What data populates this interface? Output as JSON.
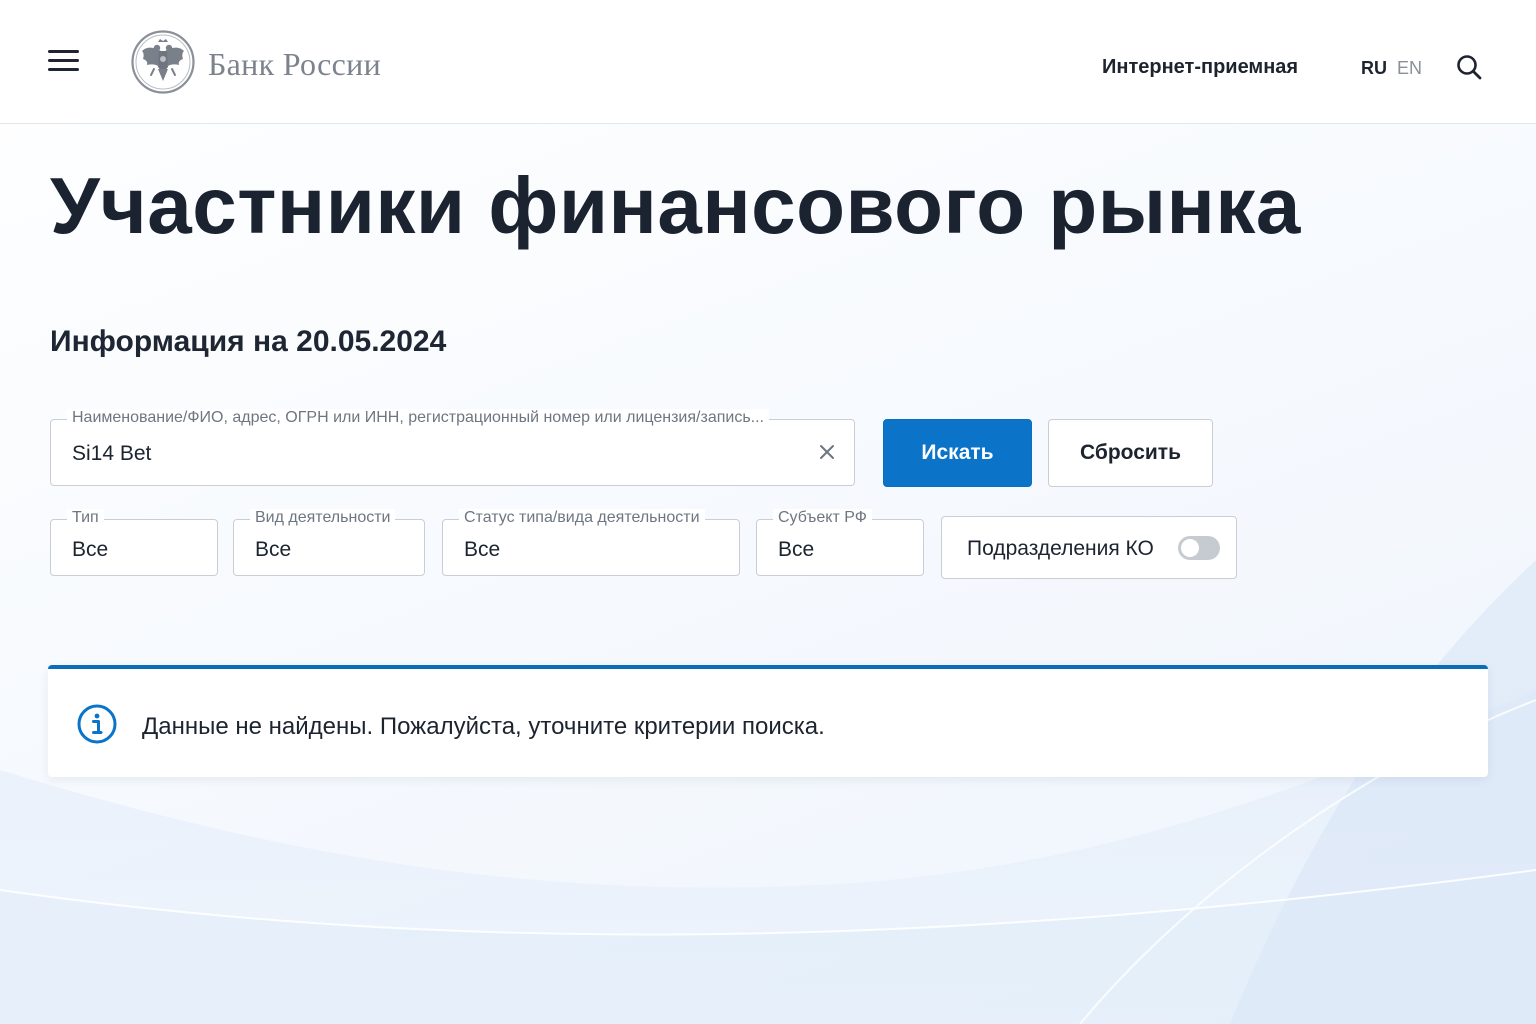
{
  "colors": {
    "primary": "#0b74c9",
    "alert_accent": "#0b6cb8",
    "text": "#1b2230",
    "muted": "#6e7682",
    "border": "#c9ced6"
  },
  "header": {
    "menu_icon": "hamburger-menu-icon",
    "logo_icon": "bank-of-russia-eagle-emblem",
    "logo_text": "Банк России",
    "nav_link": "Интернет-приемная",
    "languages": {
      "ru": "RU",
      "en": "EN",
      "active": "RU"
    },
    "search_icon": "search-icon"
  },
  "main": {
    "title": "Участники финансового рынка",
    "info_date": "Информация на 20.05.2024",
    "search": {
      "label": "Наименование/ФИО, адрес, ОГРН или ИНН, регистрационный номер или лицензия/запись...",
      "value": "Si14 Bet",
      "clear_icon": "close-icon"
    },
    "buttons": {
      "search": "Искать",
      "reset": "Сбросить"
    },
    "filters": [
      {
        "label": "Тип",
        "value": "Все"
      },
      {
        "label": "Вид деятельности",
        "value": "Все"
      },
      {
        "label": "Статус типа/вида деятельности",
        "value": "Все"
      },
      {
        "label": "Субъект РФ",
        "value": "Все"
      }
    ],
    "toggle": {
      "label": "Подразделения КО",
      "on": false
    },
    "alert": {
      "icon": "info-icon",
      "message": "Данные не найдены. Пожалуйста, уточните критерии поиска."
    }
  }
}
